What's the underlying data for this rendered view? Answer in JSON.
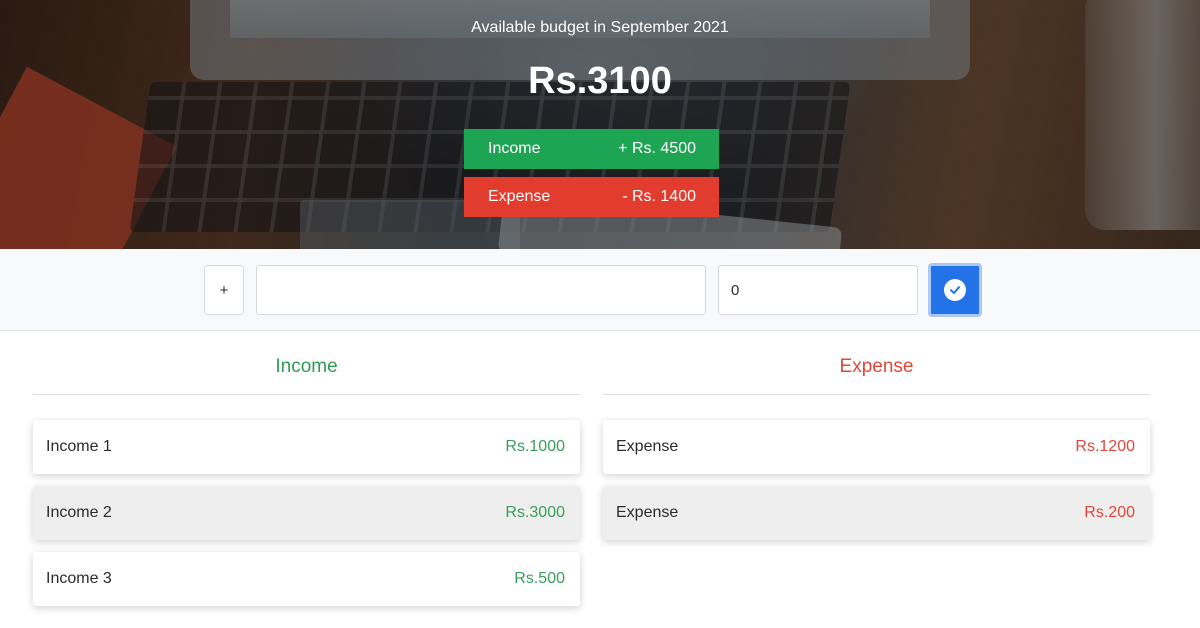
{
  "header": {
    "title": "Available budget in September 2021",
    "budget": "Rs.3100",
    "income_label": "Income",
    "income_value": "+ Rs. 4500",
    "expense_label": "Expense",
    "expense_value": "- Rs. 1400"
  },
  "add_form": {
    "type_value": "+",
    "description_value": "",
    "description_placeholder": "",
    "amount_value": "0",
    "submit_icon": "check-circle-icon"
  },
  "income": {
    "heading": "Income",
    "items": [
      {
        "label": "Income 1",
        "amount": "Rs.1000"
      },
      {
        "label": "Income 2",
        "amount": "Rs.3000"
      },
      {
        "label": "Income 3",
        "amount": "Rs.500"
      }
    ]
  },
  "expense": {
    "heading": "Expense",
    "items": [
      {
        "label": "Expense",
        "amount": "Rs.1200"
      },
      {
        "label": "Expense",
        "amount": "Rs.200"
      }
    ]
  },
  "colors": {
    "income": "#1ea554",
    "expense": "#e23c2f",
    "button": "#2372e8"
  }
}
